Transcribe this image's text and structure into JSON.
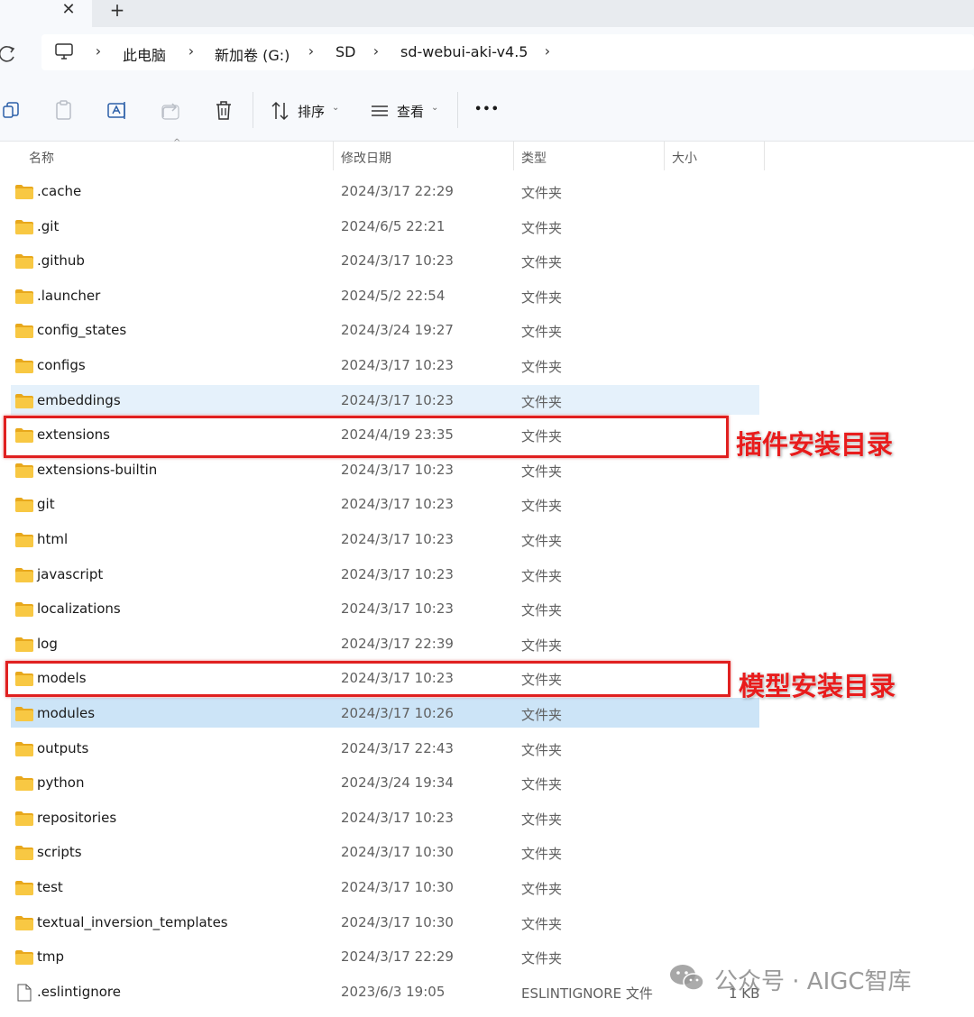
{
  "tabs": {
    "close_symbol": "✕",
    "new_symbol": "+"
  },
  "address": {
    "refresh_icon": "refresh-icon",
    "root_icon": "computer-icon",
    "separator": "›",
    "crumbs": [
      "此电脑",
      "新加卷 (G:)",
      "SD",
      "sd-webui-aki-v4.5"
    ]
  },
  "toolbar": {
    "copy_icon": "copy-icon",
    "paste_icon": "paste-icon",
    "rename_icon": "rename-icon",
    "share_icon": "share-icon",
    "delete_icon": "trash-icon",
    "sort_label": "排序",
    "view_label": "查看",
    "more_label": "•••"
  },
  "columns": {
    "name": "名称",
    "date": "修改日期",
    "type": "类型",
    "size": "大小"
  },
  "files": [
    {
      "name": ".cache",
      "date": "2024/3/17 22:29",
      "type": "文件夹",
      "size": "",
      "kind": "folder",
      "state": ""
    },
    {
      "name": ".git",
      "date": "2024/6/5 22:21",
      "type": "文件夹",
      "size": "",
      "kind": "folder",
      "state": ""
    },
    {
      "name": ".github",
      "date": "2024/3/17 10:23",
      "type": "文件夹",
      "size": "",
      "kind": "folder",
      "state": ""
    },
    {
      "name": ".launcher",
      "date": "2024/5/2 22:54",
      "type": "文件夹",
      "size": "",
      "kind": "folder",
      "state": ""
    },
    {
      "name": "config_states",
      "date": "2024/3/24 19:27",
      "type": "文件夹",
      "size": "",
      "kind": "folder",
      "state": ""
    },
    {
      "name": "configs",
      "date": "2024/3/17 10:23",
      "type": "文件夹",
      "size": "",
      "kind": "folder",
      "state": ""
    },
    {
      "name": "embeddings",
      "date": "2024/3/17 10:23",
      "type": "文件夹",
      "size": "",
      "kind": "folder",
      "state": "hover"
    },
    {
      "name": "extensions",
      "date": "2024/4/19 23:35",
      "type": "文件夹",
      "size": "",
      "kind": "folder",
      "state": ""
    },
    {
      "name": "extensions-builtin",
      "date": "2024/3/17 10:23",
      "type": "文件夹",
      "size": "",
      "kind": "folder",
      "state": ""
    },
    {
      "name": "git",
      "date": "2024/3/17 10:23",
      "type": "文件夹",
      "size": "",
      "kind": "folder",
      "state": ""
    },
    {
      "name": "html",
      "date": "2024/3/17 10:23",
      "type": "文件夹",
      "size": "",
      "kind": "folder",
      "state": ""
    },
    {
      "name": "javascript",
      "date": "2024/3/17 10:23",
      "type": "文件夹",
      "size": "",
      "kind": "folder",
      "state": ""
    },
    {
      "name": "localizations",
      "date": "2024/3/17 10:23",
      "type": "文件夹",
      "size": "",
      "kind": "folder",
      "state": ""
    },
    {
      "name": "log",
      "date": "2024/3/17 22:39",
      "type": "文件夹",
      "size": "",
      "kind": "folder",
      "state": ""
    },
    {
      "name": "models",
      "date": "2024/3/17 10:23",
      "type": "文件夹",
      "size": "",
      "kind": "folder",
      "state": ""
    },
    {
      "name": "modules",
      "date": "2024/3/17 10:26",
      "type": "文件夹",
      "size": "",
      "kind": "folder",
      "state": "selected"
    },
    {
      "name": "outputs",
      "date": "2024/3/17 22:43",
      "type": "文件夹",
      "size": "",
      "kind": "folder",
      "state": ""
    },
    {
      "name": "python",
      "date": "2024/3/24 19:34",
      "type": "文件夹",
      "size": "",
      "kind": "folder",
      "state": ""
    },
    {
      "name": "repositories",
      "date": "2024/3/17 10:23",
      "type": "文件夹",
      "size": "",
      "kind": "folder",
      "state": ""
    },
    {
      "name": "scripts",
      "date": "2024/3/17 10:30",
      "type": "文件夹",
      "size": "",
      "kind": "folder",
      "state": ""
    },
    {
      "name": "test",
      "date": "2024/3/17 10:30",
      "type": "文件夹",
      "size": "",
      "kind": "folder",
      "state": ""
    },
    {
      "name": "textual_inversion_templates",
      "date": "2024/3/17 10:30",
      "type": "文件夹",
      "size": "",
      "kind": "folder",
      "state": ""
    },
    {
      "name": "tmp",
      "date": "2024/3/17 22:29",
      "type": "文件夹",
      "size": "",
      "kind": "folder",
      "state": ""
    },
    {
      "name": ".eslintignore",
      "date": "2023/6/3 19:05",
      "type": "ESLINTIGNORE 文件",
      "size": "1 KB",
      "kind": "file",
      "state": ""
    }
  ],
  "annotations": {
    "extensions_label": "插件安装目录",
    "models_label": "模型安装目录",
    "color": "#e02020"
  },
  "watermark": {
    "icon": "wechat-icon",
    "text": "公众号 · AIGC智库"
  },
  "colors": {
    "hover": "#e5f1fb",
    "selected": "#cce4f7",
    "folder": "#f8c843"
  }
}
